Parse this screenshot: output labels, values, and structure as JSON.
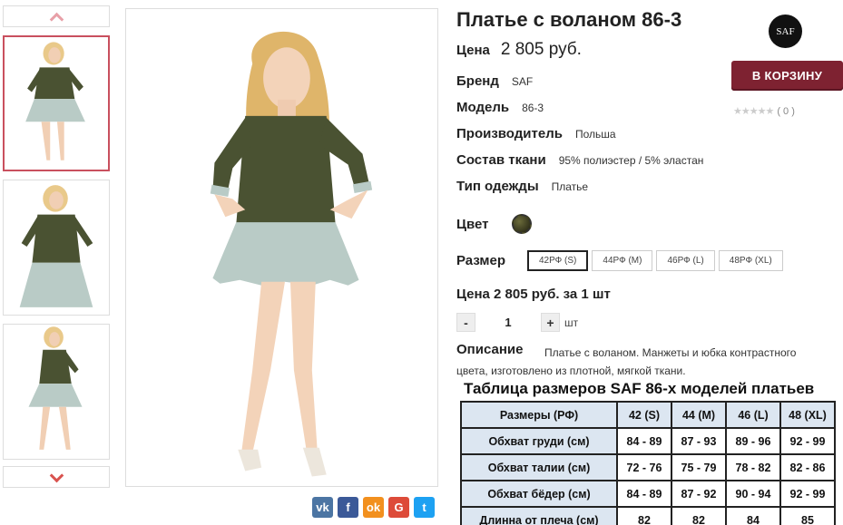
{
  "product": {
    "title": "Платье с воланом 86-3",
    "price_label": "Цена",
    "price_value": "2 805 руб.",
    "specs": [
      {
        "key": "Бренд",
        "value": "SAF"
      },
      {
        "key": "Модель",
        "value": "86-3"
      },
      {
        "key": "Производитель",
        "value": "Польша"
      },
      {
        "key": "Состав ткани",
        "value": "95% полиэстер / 5% эластан"
      },
      {
        "key": "Тип одежды",
        "value": "Платье"
      }
    ],
    "color_label": "Цвет",
    "size_label": "Размер",
    "sizes": [
      "42РФ (S)",
      "44РФ (M)",
      "46РФ (L)",
      "48РФ (XL)"
    ],
    "selected_size": "42РФ (S)",
    "price_per_unit": "Цена 2 805 руб. за 1 шт",
    "quantity": "1",
    "qty_minus": "-",
    "qty_plus": "+",
    "qty_unit": "шт",
    "description_label": "Описание",
    "description": "Платье с воланом. Манжеты и юбка контрастного цвета, изготовлено из плотной, мягкой ткани."
  },
  "brand_logo": "SAF",
  "cart_button": "В КОРЗИНУ",
  "rating": {
    "stars": "★★★★★",
    "count": "( 0 )"
  },
  "social": [
    {
      "icon": "vk-icon",
      "glyph": "vk",
      "color": "#4c75a3"
    },
    {
      "icon": "facebook-icon",
      "glyph": "f",
      "color": "#3b5998"
    },
    {
      "icon": "odnoklassniki-icon",
      "glyph": "ok",
      "color": "#f2901e"
    },
    {
      "icon": "googleplus-icon",
      "glyph": "G",
      "color": "#dd4b39"
    },
    {
      "icon": "twitter-icon",
      "glyph": "t",
      "color": "#1da1f2"
    }
  ],
  "size_table": {
    "title": "Таблица размеров SAF 86-х моделей платьев",
    "headers": [
      "Размеры (РФ)",
      "42 (S)",
      "44 (M)",
      "46 (L)",
      "48 (XL)"
    ],
    "rows": [
      [
        "Обхват груди (см)",
        "84 - 89",
        "87 - 93",
        "89 - 96",
        "92 - 99"
      ],
      [
        "Обхват талии (см)",
        "72 - 76",
        "75 - 79",
        "78 - 82",
        "82 - 86"
      ],
      [
        "Обхват бёдер (см)",
        "84 - 89",
        "87 - 92",
        "90 - 94",
        "92 - 99"
      ],
      [
        "Длинна от плеча (см)",
        "82",
        "82",
        "84",
        "85"
      ]
    ]
  },
  "colors": {
    "accent": "#7e2231",
    "thumb_active_border": "#c9505e",
    "dress": "#4a5232",
    "skirt": "#b9cbc6",
    "table_header": "#dce6f1"
  }
}
